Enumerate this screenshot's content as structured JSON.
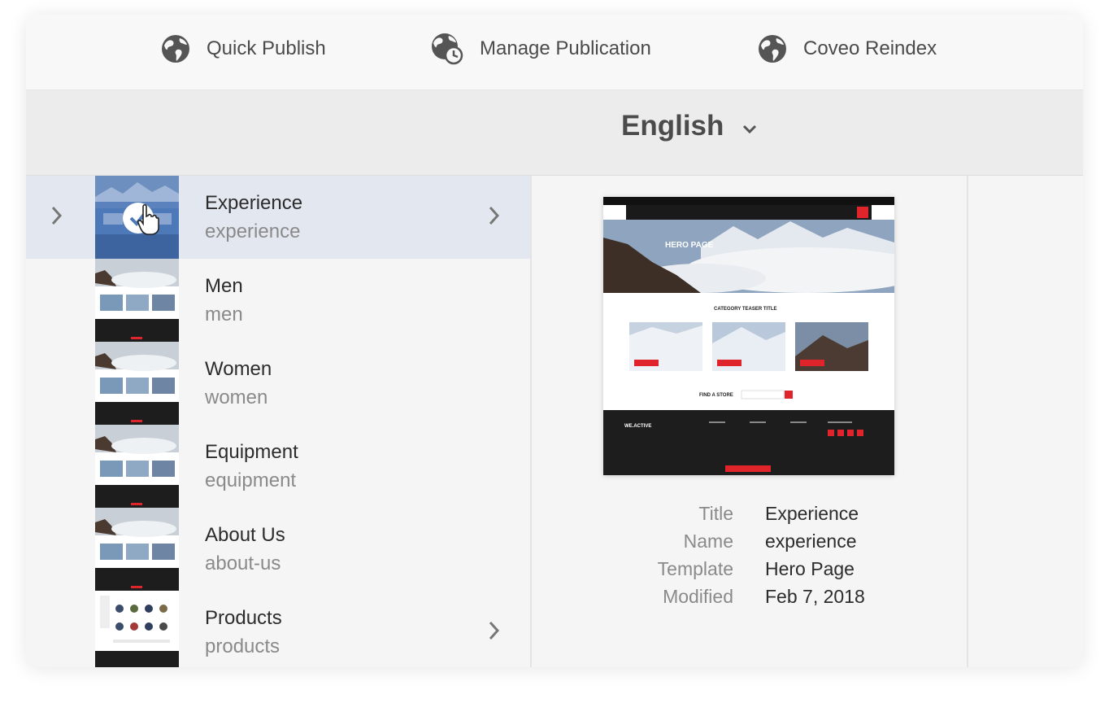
{
  "toolbar": {
    "quick_publish_label": "Quick Publish",
    "manage_publication_label": "Manage Publication",
    "coveo_reindex_label": "Coveo Reindex"
  },
  "language": {
    "selected": "English"
  },
  "pages": [
    {
      "title": "Experience",
      "name": "experience",
      "selected": true,
      "has_children": true
    },
    {
      "title": "Men",
      "name": "men",
      "selected": false,
      "has_children": false
    },
    {
      "title": "Women",
      "name": "women",
      "selected": false,
      "has_children": false
    },
    {
      "title": "Equipment",
      "name": "equipment",
      "selected": false,
      "has_children": false
    },
    {
      "title": "About Us",
      "name": "about-us",
      "selected": false,
      "has_children": false
    },
    {
      "title": "Products",
      "name": "products",
      "selected": false,
      "has_children": true
    }
  ],
  "preview": {
    "hero_text": "HERO PAGE",
    "category_title": "CATEGORY TEASER TITLE",
    "find_store": "FIND A STORE",
    "footer_logo": "WE.ACTIVE"
  },
  "details": {
    "labels": {
      "title": "Title",
      "name": "Name",
      "template": "Template",
      "modified": "Modified"
    },
    "values": {
      "title": "Experience",
      "name": "experience",
      "template": "Hero Page",
      "modified": "Feb 7, 2018"
    }
  },
  "colors": {
    "selection": "#e2e7f0",
    "text": "#2c2c2c",
    "muted": "#8a8a8a",
    "accent_red": "#e0242b"
  },
  "icons": [
    "globe-icon",
    "globe-clock-icon",
    "globe-icon",
    "chevron-down-icon",
    "chevron-right-icon",
    "checkmark-icon",
    "hand-cursor-icon"
  ]
}
